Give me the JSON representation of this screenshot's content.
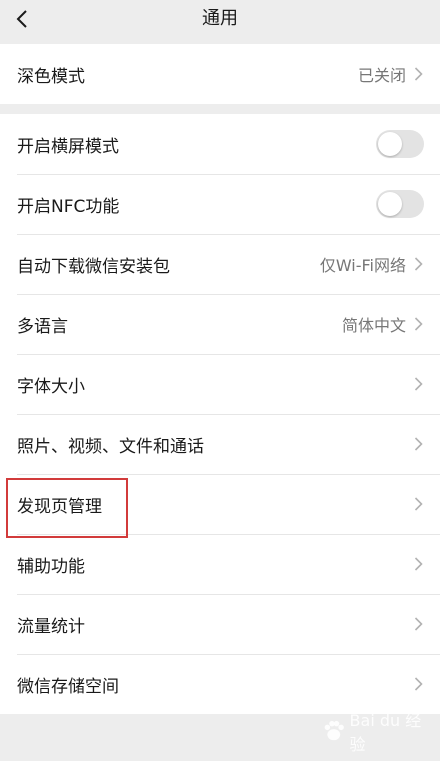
{
  "header": {
    "title": "通用"
  },
  "dark_mode": {
    "label": "深色模式",
    "value": "已关闭"
  },
  "settings": [
    {
      "label": "开启横屏模式",
      "type": "toggle",
      "on": false
    },
    {
      "label": "开启NFC功能",
      "type": "toggle",
      "on": false
    },
    {
      "label": "自动下载微信安装包",
      "type": "nav",
      "value": "仅Wi-Fi网络"
    },
    {
      "label": "多语言",
      "type": "nav",
      "value": "简体中文"
    },
    {
      "label": "字体大小",
      "type": "nav",
      "value": ""
    },
    {
      "label": "照片、视频、文件和通话",
      "type": "nav",
      "value": ""
    },
    {
      "label": "发现页管理",
      "type": "nav",
      "value": ""
    },
    {
      "label": "辅助功能",
      "type": "nav",
      "value": ""
    },
    {
      "label": "流量统计",
      "type": "nav",
      "value": ""
    },
    {
      "label": "微信存储空间",
      "type": "nav",
      "value": ""
    }
  ],
  "watermark": {
    "text": "Bai du 经验"
  },
  "colors": {
    "background": "#ededed",
    "card": "#ffffff",
    "highlight_border": "#d23b3b",
    "toggle_off": "#e3e3e3"
  },
  "icons": {
    "back": "chevron-left-icon",
    "row_arrow": "chevron-right-icon"
  }
}
